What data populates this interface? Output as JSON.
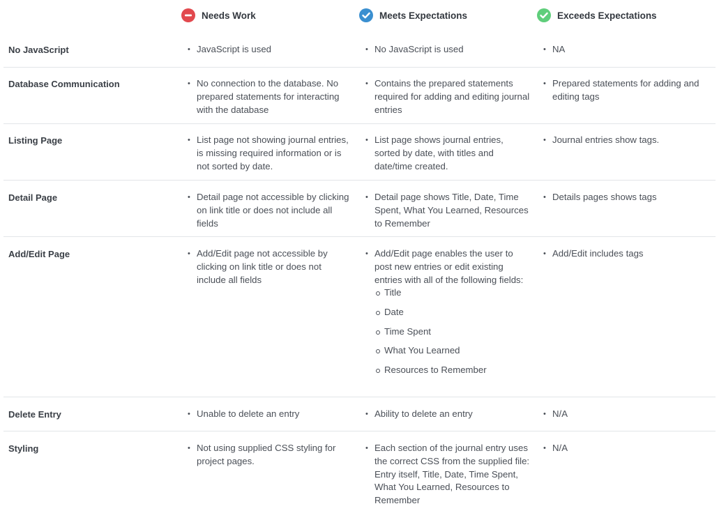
{
  "header": {
    "needs_work": "Needs Work",
    "meets": "Meets Expectations",
    "exceeds": "Exceeds Expectations",
    "colors": {
      "needs_work": "#e2494e",
      "meets": "#3a8fd0",
      "exceeds": "#5fce7b"
    },
    "icons": {
      "needs_work": "minus-circle-icon",
      "meets": "check-circle-icon",
      "exceeds": "check-circle-icon"
    }
  },
  "rows": [
    {
      "criterion": "No JavaScript",
      "needs_work": "JavaScript is used",
      "meets": "No JavaScript is used",
      "exceeds": "NA"
    },
    {
      "criterion": "Database Communication",
      "needs_work": "No connection to the database. No prepared statements for interacting with the database",
      "meets": "Contains the prepared statements required for adding and editing journal entries",
      "exceeds": "Prepared statements for adding and editing tags"
    },
    {
      "criterion": "Listing Page",
      "needs_work": "List page not showing journal entries, is missing required information or is not sorted by date.",
      "meets": "List page shows journal entries, sorted by date, with titles and date/time created.",
      "exceeds": "Journal entries show tags."
    },
    {
      "criterion": "Detail Page",
      "needs_work": "Detail page not accessible by clicking on link title or does not include all fields",
      "meets": "Detail page shows Title, Date, Time Spent, What You Learned, Resources to Remember",
      "exceeds": "Details pages shows tags"
    },
    {
      "criterion": "Add/Edit Page",
      "needs_work": "Add/Edit page not accessible by clicking on link title or does not include all fields",
      "meets": "Add/Edit page enables the user to post new entries or edit existing entries with all of the following fields:",
      "meets_sub": [
        "Title",
        "Date",
        "Time Spent",
        "What You Learned",
        "Resources to Remember"
      ],
      "exceeds": "Add/Edit includes tags"
    },
    {
      "criterion": "Delete Entry",
      "needs_work": "Unable to delete an entry",
      "meets": "Ability to delete an entry",
      "exceeds": "N/A"
    },
    {
      "criterion": "Styling",
      "needs_work": "Not using supplied CSS styling for project pages.",
      "meets": "Each section of the journal entry uses the correct CSS from the supplied file: Entry itself, Title, Date, Time Spent, What You Learned, Resources to Remember",
      "exceeds": "N/A"
    }
  ]
}
